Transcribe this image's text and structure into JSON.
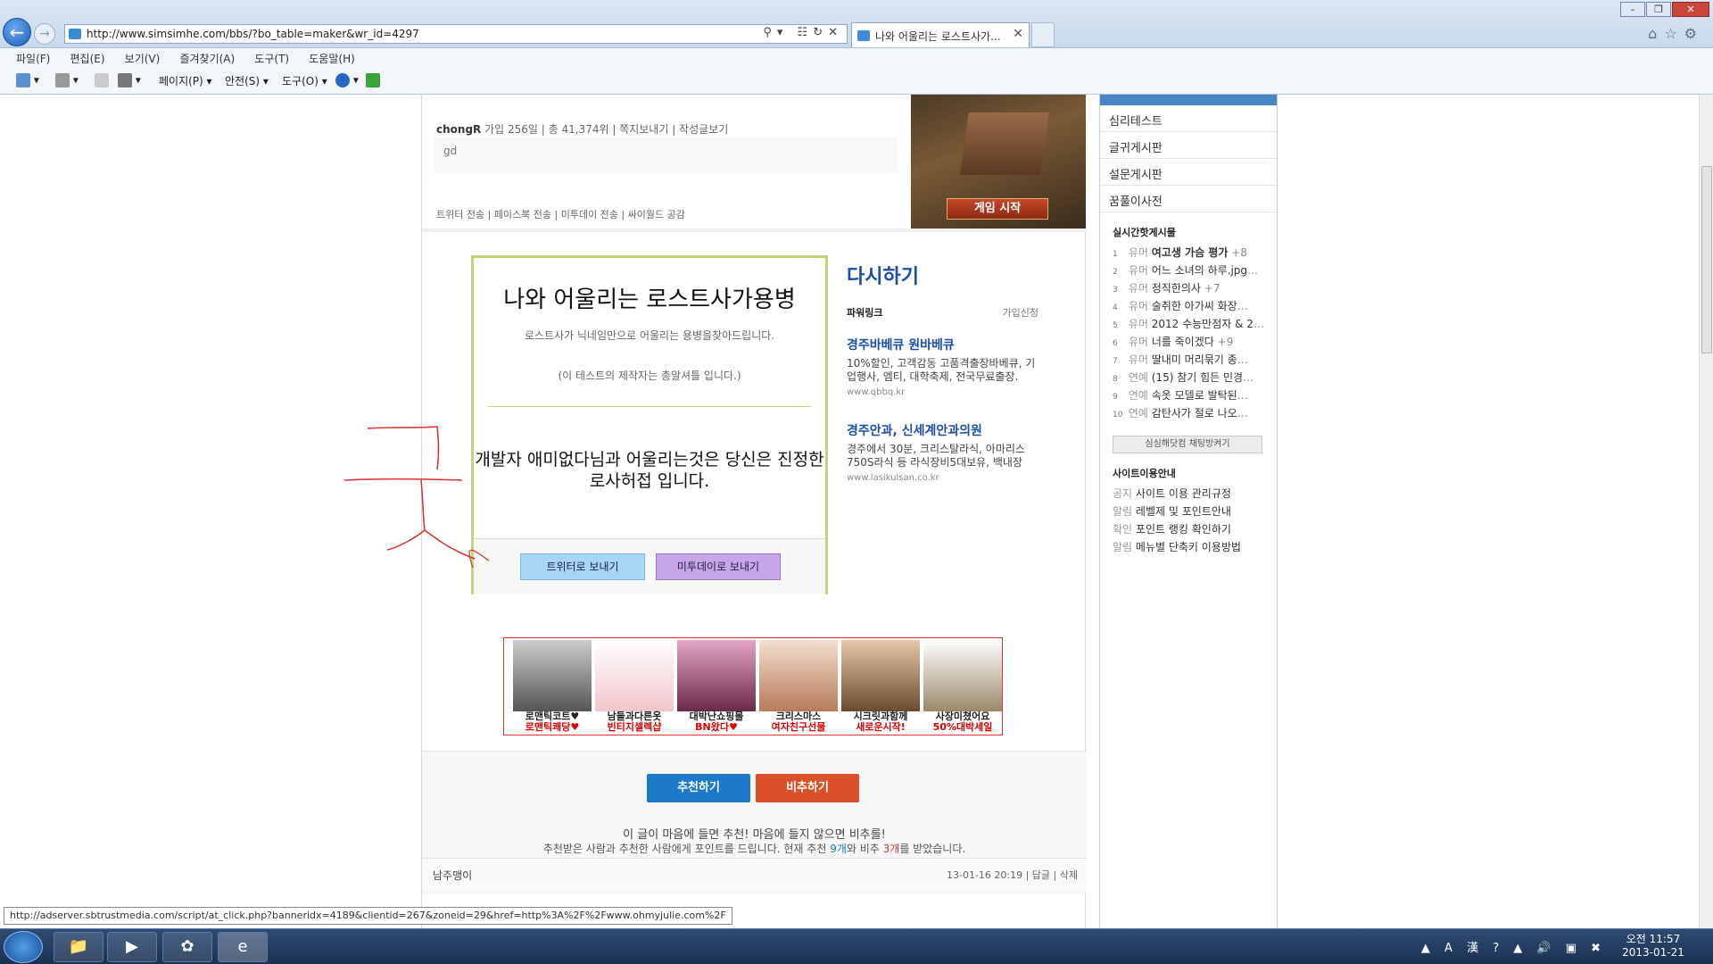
{
  "browser": {
    "url": "http://www.simsimhe.com/bbs/?bo_table=maker&wr_id=4297",
    "tab_title": "나와 어울리는 로스트사가...",
    "menu": [
      "파일(F)",
      "편집(E)",
      "보기(V)",
      "즐겨찾기(A)",
      "도구(T)",
      "도움말(H)"
    ],
    "cmd": {
      "page": "페이지(P) ▾",
      "safety": "안전(S) ▾",
      "tools": "도구(O) ▾"
    },
    "status_url": "http://adserver.sbtrustmedia.com/script/at_click.php?banneridx=4189&clientid=267&zoneid=29&href=http%3A%2F%2Fwww.ohmyjulie.com%2F"
  },
  "post": {
    "author": "chongR",
    "author_meta": "가입 256일  |  총 41,374위  |  쪽지보내기  |  작성글보기",
    "body": "gd",
    "share": "트위터 전송 | 페이스북 전송 | 미투데이 전송 | 싸이월드 공감",
    "game_button": "게임 시작"
  },
  "test": {
    "title": "나와 어울리는 로스트사가용병",
    "desc": "로스트사가 닉네임만으로 어울리는 용병을찾아드립니다.",
    "maker": "(이 테스트의 제작자는 총알셔틀 입니다.)",
    "result": "개발자 애미없다님과 어울리는것은 당신은 진정한 로사허접 입니다.",
    "twitter_btn": "트위터로 보내기",
    "me2day_btn": "미투데이로 보내기",
    "retry": "다시하기"
  },
  "ads": {
    "powerlink": "파워링크",
    "join": "가입신청",
    "items": [
      {
        "title": "경주바베큐 원바베큐",
        "body": "10%할인, 고객감동 고품격출장바베큐, 기업행사, 엠티, 대학축제, 전국무료출장.",
        "url": "www.qbbq.kr"
      },
      {
        "title": "경주안과, 신세계안과의원",
        "body": "경주에서 30분, 크리스탈라식, 아마리스750S라식 등 라식장비5대보유, 백내장",
        "url": "www.lasikulsan.co.kr"
      }
    ]
  },
  "banner": [
    {
      "c1": "로맨틱코트♥",
      "c2": "로맨틱쾌당♥"
    },
    {
      "c1": "남들과다른옷",
      "c2": "빈티지셀렉샵"
    },
    {
      "c1": "대박난쇼핑몰",
      "c2": "BN왔다♥"
    },
    {
      "c1": "크리스마스",
      "c2": "여자친구선물"
    },
    {
      "c1": "시크릿과함께",
      "c2": "새로운시작!"
    },
    {
      "c1": "사장미쳤어요",
      "c2": "50%대박세일"
    }
  ],
  "recommend": {
    "rec_btn": "추천하기",
    "nrec_btn": "비추하기",
    "msg1": "이 글이 마음에 들면 추천! 마음에 들지 않으면 비추를!",
    "msg2_a": "추천받은 사람과 추천한 사람에게 포인트를 드립니다. 현재 추천 ",
    "msg2_rec": "9개",
    "msg2_b": "와 비추 ",
    "msg2_nrec": "3개",
    "msg2_c": "를 받았습니다."
  },
  "comment": {
    "name": "남주맹이",
    "meta": "13-01-16 20:19  |  답글  |  삭제"
  },
  "sidebar": {
    "menu": [
      "심리테스트",
      "글귀게시판",
      "설문게시판",
      "꿈풀이사전"
    ],
    "hot_title": "실시간핫게시물",
    "hot": [
      {
        "n": "1",
        "cat": "유머",
        "t": "여고생 가슴 평가",
        "c": "+8"
      },
      {
        "n": "2",
        "cat": "유머",
        "t": "어느 소녀의 하루.jpg",
        "c": "…"
      },
      {
        "n": "3",
        "cat": "유머",
        "t": "정직한의사",
        "c": "+7"
      },
      {
        "n": "4",
        "cat": "유머",
        "t": "술취한 아가씨 화장",
        "c": "…"
      },
      {
        "n": "5",
        "cat": "유머",
        "t": "2012 수능만점자 & 2",
        "c": "…"
      },
      {
        "n": "6",
        "cat": "유머",
        "t": "너를 죽이겠다",
        "c": "+9"
      },
      {
        "n": "7",
        "cat": "유머",
        "t": "딸내미 머리묶기 종",
        "c": "…"
      },
      {
        "n": "8",
        "cat": "연예",
        "t": "(15) 참기 힘든 민경",
        "c": "…"
      },
      {
        "n": "9",
        "cat": "연예",
        "t": "속옷 모델로 발탁된",
        "c": "…"
      },
      {
        "n": "10",
        "cat": "연예",
        "t": "감탄사가 절로 나오",
        "c": "…"
      }
    ],
    "chat_btn": "심심해닷컴 채팅방켜기",
    "notice_title": "사이트이용안내",
    "notices": [
      {
        "k": "공지",
        "t": "사이트 이용 관리규정"
      },
      {
        "k": "알림",
        "t": "레벨제 및 포인트안내"
      },
      {
        "k": "확인",
        "t": "포인트 랭킹 확인하기"
      },
      {
        "k": "알림",
        "t": "메뉴별 단축키 이용방법"
      }
    ]
  },
  "taskbar": {
    "time": "오전 11:57",
    "date": "2013-01-21"
  },
  "colors": {
    "accent": "#1a4ea8",
    "test_border": "#c5d476",
    "rec": "#1d79c9",
    "nrec": "#d9502b"
  }
}
